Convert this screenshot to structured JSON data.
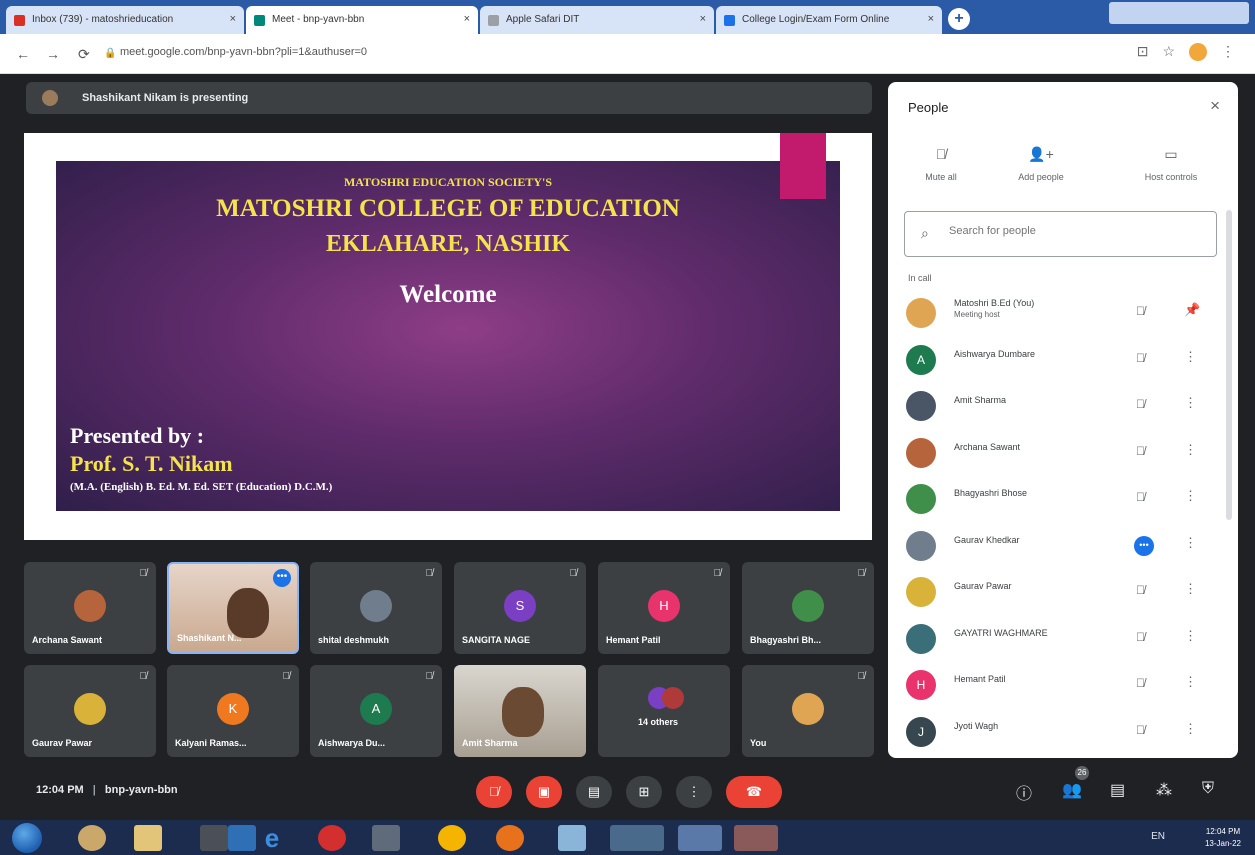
{
  "browser": {
    "tabs": [
      {
        "label": "Inbox (739) - matoshrieducation",
        "color": "#d93025"
      },
      {
        "label": "Meet - bnp-yavn-bbn",
        "color": "#00897b"
      },
      {
        "label": "Apple Safari DIT",
        "color": "#9aa0a6"
      },
      {
        "label": "College Login/Exam Form Online",
        "color": "#1a73e8"
      }
    ],
    "url": "meet.google.com/bnp-yavn-bbn?pli=1&authuser=0",
    "close_glyph": "×",
    "new_tab_glyph": "+"
  },
  "meeting": {
    "presenting_text": "Shashikant Nikam is presenting",
    "time": "12:04 PM",
    "separator": "|",
    "code": "bnp-yavn-bbn"
  },
  "slide": {
    "society": "MATOSHRI EDUCATION SOCIETY'S",
    "college": "MATOSHRI COLLEGE OF EDUCATION",
    "place": "EKLAHARE, NASHIK",
    "welcome": "Welcome",
    "presented_by": "Presented by :",
    "presenter": "Prof. S. T. Nikam",
    "qualifications": "(M.A. (English) B. Ed. M. Ed. SET (Education) D.C.M.)"
  },
  "tiles": [
    {
      "name": "Archana Sawant"
    },
    {
      "name": "Shashikant N..."
    },
    {
      "name": "shital deshmukh"
    },
    {
      "name": "SANGITA NAGE",
      "initial": "S"
    },
    {
      "name": "Hemant Patil",
      "initial": "H"
    },
    {
      "name": "Bhagyashri Bh..."
    },
    {
      "name": "Gaurav Pawar"
    },
    {
      "name": "Kalyani Ramas...",
      "initial": "K"
    },
    {
      "name": "Aishwarya Du...",
      "initial": "A"
    },
    {
      "name": "Amit Sharma"
    },
    {
      "name": "14 others"
    },
    {
      "name": "You"
    }
  ],
  "people_panel": {
    "title": "People",
    "close_glyph": "×",
    "actions": [
      {
        "label": "Mute all"
      },
      {
        "label": "Add people"
      },
      {
        "label": "Host controls"
      }
    ],
    "search_placeholder": "Search for people",
    "in_call_label": "In call",
    "people": [
      {
        "name": "Matoshri B.Ed (You)",
        "sub": "Meeting host"
      },
      {
        "name": "Aishwarya Dumbare",
        "initial": "A"
      },
      {
        "name": "Amit Sharma"
      },
      {
        "name": "Archana Sawant"
      },
      {
        "name": "Bhagyashri Bhose"
      },
      {
        "name": "Gaurav Khedkar"
      },
      {
        "name": "Gaurav Pawar"
      },
      {
        "name": "GAYATRI WAGHMARE"
      },
      {
        "name": "Hemant Patil",
        "initial": "H"
      },
      {
        "name": "Jyoti Wagh",
        "initial": "J"
      }
    ]
  },
  "bottom": {
    "people_count": "26",
    "dots_glyph": "•••",
    "more_glyph": "⋮"
  },
  "taskbar": {
    "tray_text": "EN",
    "clock_time": "12:04 PM",
    "clock_date": "13-Jan-22"
  },
  "colors": {
    "accent": "#1a73e8",
    "end_call": "#ea4335",
    "slide_title": "#f4e34b"
  }
}
